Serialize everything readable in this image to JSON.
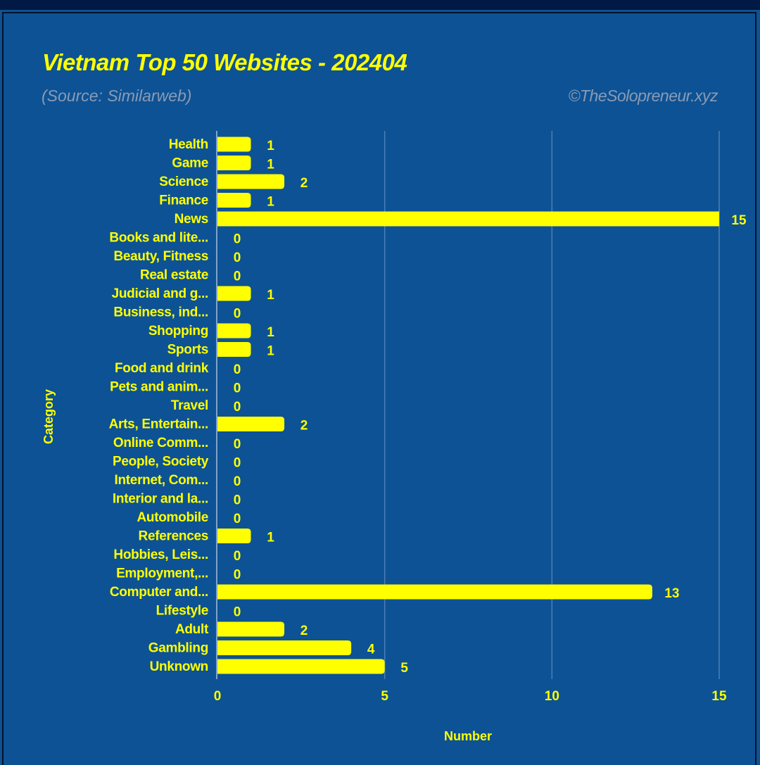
{
  "chart_data": {
    "type": "bar",
    "orientation": "horizontal",
    "title": "Vietnam Top 50 Websites - 202404",
    "subtitle": "(Source: Similarweb)",
    "credit": "©TheSolopreneur.xyz",
    "xlabel": "Number",
    "ylabel": "Category",
    "xlim": [
      0,
      15
    ],
    "xticks": [
      0,
      5,
      10,
      15
    ],
    "grid": true,
    "legend": "none",
    "categories": [
      "Health",
      "Game",
      "Science",
      "Finance",
      "News",
      "Books and lite...",
      "Beauty, Fitness",
      "Real estate",
      "Judicial and g...",
      "Business, ind...",
      "Shopping",
      "Sports",
      "Food and drink",
      "Pets and anim...",
      "Travel",
      "Arts, Entertain...",
      "Online Comm...",
      "People, Society",
      "Internet, Com...",
      "Interior and la...",
      "Automobile",
      "References",
      "Hobbies, Leis...",
      "Employment,...",
      "Computer and...",
      "Lifestyle",
      "Adult",
      "Gambling",
      "Unknown"
    ],
    "values": [
      1,
      1,
      2,
      1,
      15,
      0,
      0,
      0,
      1,
      0,
      1,
      1,
      0,
      0,
      0,
      2,
      0,
      0,
      0,
      0,
      0,
      1,
      0,
      0,
      13,
      0,
      2,
      4,
      5
    ],
    "colors": {
      "bar": "#ffff00",
      "text": "#ffff00",
      "background": "#0d5294",
      "grid": "#4b7fb8",
      "muted_text": "#8a9bb5"
    }
  }
}
